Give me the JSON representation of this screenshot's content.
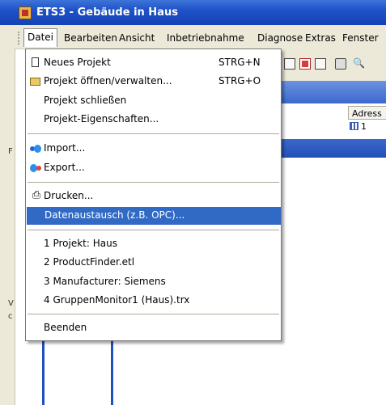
{
  "window": {
    "title": "ETS3 - Gebäude in Haus"
  },
  "menubar": {
    "items": [
      {
        "label": "Datei",
        "active": true
      },
      {
        "label": "Bearbeiten"
      },
      {
        "label": "Ansicht"
      },
      {
        "label": "Inbetriebnahme"
      },
      {
        "label": "Diagnose"
      },
      {
        "label": "Extras"
      },
      {
        "label": "Fenster"
      }
    ]
  },
  "file_menu": {
    "items": [
      {
        "label": "Neues Projekt",
        "shortcut": "STRG+N",
        "icon": "new-document-icon"
      },
      {
        "label": "Projekt öffnen/verwalten...",
        "shortcut": "STRG+O",
        "icon": "open-folder-icon"
      },
      {
        "label": "Projekt schließen"
      },
      {
        "label": "Projekt-Eigenschaften..."
      },
      {
        "label": "Import...",
        "icon": "import-icon"
      },
      {
        "label": "Export...",
        "icon": "export-icon"
      },
      {
        "label": "Drucken...",
        "icon": "printer-icon"
      },
      {
        "label": "Datenaustausch (z.B. OPC)...",
        "highlighted": true
      },
      {
        "label": "1 Projekt: Haus"
      },
      {
        "label": "2 ProductFinder.etl"
      },
      {
        "label": "3 Manufacturer: Siemens"
      },
      {
        "label": "4 GruppenMonitor1 (Haus).trx"
      },
      {
        "label": "Beenden"
      }
    ]
  },
  "background_window": {
    "column_header": "Adress",
    "row_value": "1",
    "side_marks": [
      "F",
      "V",
      "c"
    ]
  },
  "colors": {
    "highlight": "#316ac5",
    "titlebar": "#1f52c8",
    "menubar_bg": "#ece9d8"
  }
}
